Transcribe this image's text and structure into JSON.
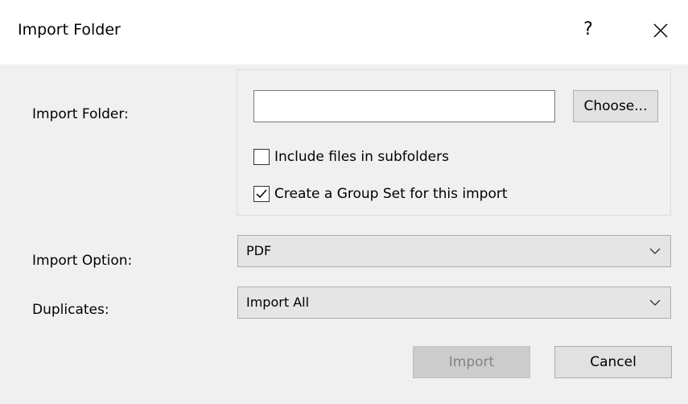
{
  "window": {
    "title": "Import Folder",
    "help_label": "?",
    "close_icon": "close-icon"
  },
  "folder": {
    "label": "Import Folder:",
    "path_value": "",
    "choose_label": "Choose...",
    "include_subfolders": {
      "label": "Include files in subfolders",
      "checked": false
    },
    "create_group_set": {
      "label": "Create a Group Set for this import",
      "checked": true
    }
  },
  "import_option": {
    "label": "Import Option:",
    "selected": "PDF"
  },
  "duplicates": {
    "label": "Duplicates:",
    "selected": "Import All"
  },
  "buttons": {
    "import_label": "Import",
    "import_enabled": false,
    "cancel_label": "Cancel"
  },
  "colors": {
    "client_background": "#f0f0f0",
    "button_face": "#e1e1e1",
    "disabled_text": "#838383"
  }
}
